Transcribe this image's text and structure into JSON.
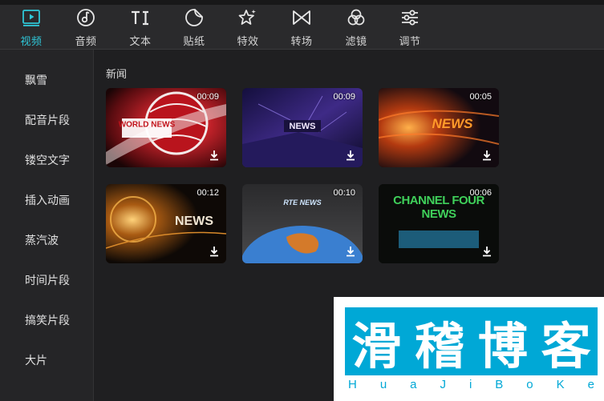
{
  "toolbar": {
    "tabs": [
      {
        "label": "视频",
        "icon": "video-play-icon",
        "active": true
      },
      {
        "label": "音频",
        "icon": "music-note-icon",
        "active": false
      },
      {
        "label": "文本",
        "icon": "text-ti-icon",
        "active": false
      },
      {
        "label": "贴纸",
        "icon": "sticker-icon",
        "active": false
      },
      {
        "label": "特效",
        "icon": "sparkle-star-icon",
        "active": false
      },
      {
        "label": "转场",
        "icon": "bowtie-transition-icon",
        "active": false
      },
      {
        "label": "滤镜",
        "icon": "filter-circles-icon",
        "active": false
      },
      {
        "label": "调节",
        "icon": "sliders-icon",
        "active": false
      }
    ],
    "accent_color": "#2fc7d8"
  },
  "sidebar": {
    "items": [
      {
        "label": "飘雪"
      },
      {
        "label": "配音片段"
      },
      {
        "label": "镂空文字"
      },
      {
        "label": "插入动画"
      },
      {
        "label": "蒸汽波"
      },
      {
        "label": "时间片段"
      },
      {
        "label": "搞笑片段"
      },
      {
        "label": "大片"
      }
    ]
  },
  "main": {
    "section_title": "新闻",
    "clips": [
      {
        "title": "WORLD NEWS",
        "duration": "00:09",
        "theme": "red-globe"
      },
      {
        "title": "NEWS",
        "duration": "00:09",
        "theme": "purple-stage"
      },
      {
        "title": "NEWS",
        "duration": "00:05",
        "theme": "orange-blur"
      },
      {
        "title": "NEWS",
        "duration": "00:12",
        "theme": "gold-globe"
      },
      {
        "title": "RTE NEWS",
        "duration": "00:10",
        "theme": "blue-earth"
      },
      {
        "title": "CHANNEL FOUR NEWS",
        "duration": "00:06",
        "theme": "green-neon"
      }
    ]
  },
  "watermark": {
    "chars": [
      "滑",
      "稽",
      "博",
      "客"
    ],
    "latin": [
      "H",
      "u",
      "a",
      "J",
      "i",
      "B",
      "o",
      "K",
      "e"
    ],
    "color": "#00a8d6"
  }
}
